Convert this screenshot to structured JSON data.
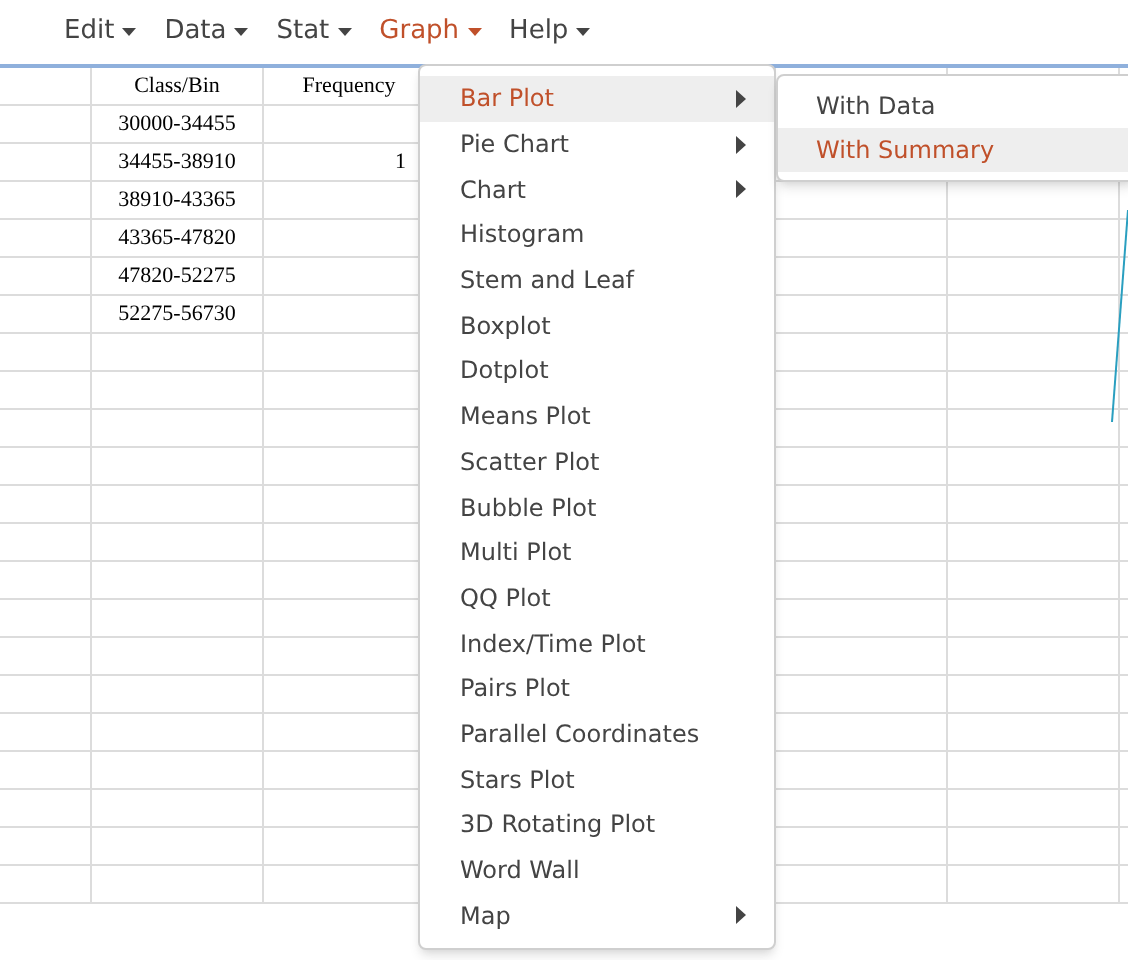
{
  "menubar": [
    {
      "label": "Edit",
      "selected": false
    },
    {
      "label": "Data",
      "selected": false
    },
    {
      "label": "Stat",
      "selected": false
    },
    {
      "label": "Graph",
      "selected": true
    },
    {
      "label": "Help",
      "selected": false
    }
  ],
  "sheet": {
    "columns": [
      "Class/Bin",
      "Frequency"
    ],
    "rows": [
      [
        "30000-34455",
        ""
      ],
      [
        "34455-38910",
        "1"
      ],
      [
        "38910-43365",
        ""
      ],
      [
        "43365-47820",
        ""
      ],
      [
        "47820-52275",
        ""
      ],
      [
        "52275-56730",
        ""
      ]
    ]
  },
  "graph_menu": [
    {
      "label": "Bar Plot",
      "selected": true,
      "submenu": true
    },
    {
      "label": "Pie Chart",
      "selected": false,
      "submenu": true
    },
    {
      "label": "Chart",
      "selected": false,
      "submenu": true
    },
    {
      "label": "Histogram",
      "selected": false,
      "submenu": false
    },
    {
      "label": "Stem and Leaf",
      "selected": false,
      "submenu": false
    },
    {
      "label": "Boxplot",
      "selected": false,
      "submenu": false
    },
    {
      "label": "Dotplot",
      "selected": false,
      "submenu": false
    },
    {
      "label": "Means Plot",
      "selected": false,
      "submenu": false
    },
    {
      "label": "Scatter Plot",
      "selected": false,
      "submenu": false
    },
    {
      "label": "Bubble Plot",
      "selected": false,
      "submenu": false
    },
    {
      "label": "Multi Plot",
      "selected": false,
      "submenu": false
    },
    {
      "label": "QQ Plot",
      "selected": false,
      "submenu": false
    },
    {
      "label": "Index/Time Plot",
      "selected": false,
      "submenu": false
    },
    {
      "label": "Pairs Plot",
      "selected": false,
      "submenu": false
    },
    {
      "label": "Parallel Coordinates",
      "selected": false,
      "submenu": false
    },
    {
      "label": "Stars Plot",
      "selected": false,
      "submenu": false
    },
    {
      "label": "3D Rotating Plot",
      "selected": false,
      "submenu": false
    },
    {
      "label": "Word Wall",
      "selected": false,
      "submenu": false
    },
    {
      "label": "Map",
      "selected": false,
      "submenu": true
    }
  ],
  "bar_plot_submenu": [
    {
      "label": "With Data",
      "selected": false
    },
    {
      "label": "With Summary",
      "selected": true
    }
  ]
}
